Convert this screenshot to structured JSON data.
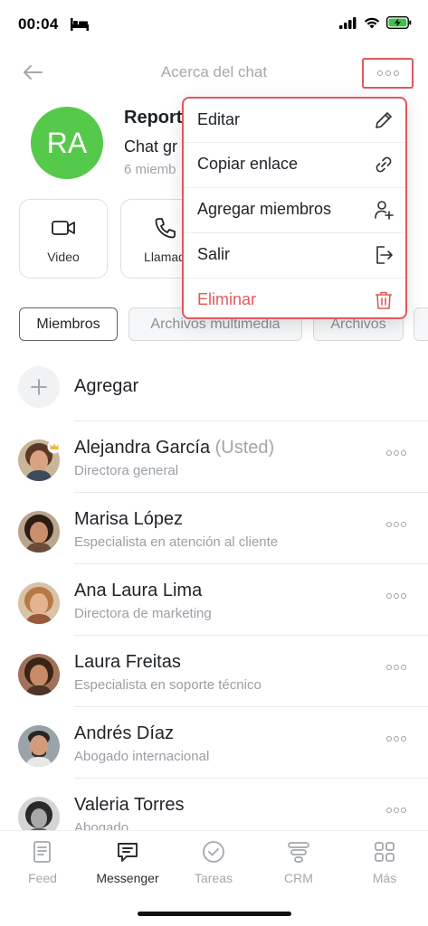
{
  "status_bar": {
    "time": "00:04"
  },
  "header": {
    "title": "Acerca del chat"
  },
  "chat": {
    "avatar_initials": "RA",
    "avatar_color": "#55c94a",
    "name": "Report",
    "type": "Chat gr",
    "members": "6 miemb"
  },
  "actions": [
    {
      "label": "Video",
      "icon": "video-camera-icon"
    },
    {
      "label": "Llamad",
      "icon": "phone-icon"
    }
  ],
  "tabs": [
    "Miembros",
    "Archivos multimedia",
    "Archivos"
  ],
  "add_label": "Agregar",
  "members": [
    {
      "name": "Alejandra García",
      "you": "(Usted)",
      "role": "Directora general"
    },
    {
      "name": "Marisa López",
      "role": "Especialista en atención al cliente"
    },
    {
      "name": "Ana Laura Lima",
      "role": "Directora de marketing"
    },
    {
      "name": "Laura Freitas",
      "role": "Especialista en soporte técnico"
    },
    {
      "name": "Andrés Díaz",
      "role": "Abogado internacional"
    },
    {
      "name": "Valeria Torres",
      "role": "Abogado"
    }
  ],
  "menu": [
    {
      "label": "Editar",
      "icon": "pencil-icon"
    },
    {
      "label": "Copiar enlace",
      "icon": "link-icon"
    },
    {
      "label": "Agregar miembros",
      "icon": "add-user-icon"
    },
    {
      "label": "Salir",
      "icon": "logout-icon"
    },
    {
      "label": "Eliminar",
      "icon": "trash-icon",
      "danger": true
    }
  ],
  "nav": [
    {
      "label": "Feed",
      "icon": "feed-icon"
    },
    {
      "label": "Messenger",
      "icon": "messenger-icon",
      "active": true
    },
    {
      "label": "Tareas",
      "icon": "tasks-icon"
    },
    {
      "label": "CRM",
      "icon": "crm-icon"
    },
    {
      "label": "Más",
      "icon": "grid-icon"
    }
  ],
  "colors": {
    "accent_danger": "#e25a5a",
    "highlight_border": "#e0585e",
    "battery": "#3fc24b"
  }
}
